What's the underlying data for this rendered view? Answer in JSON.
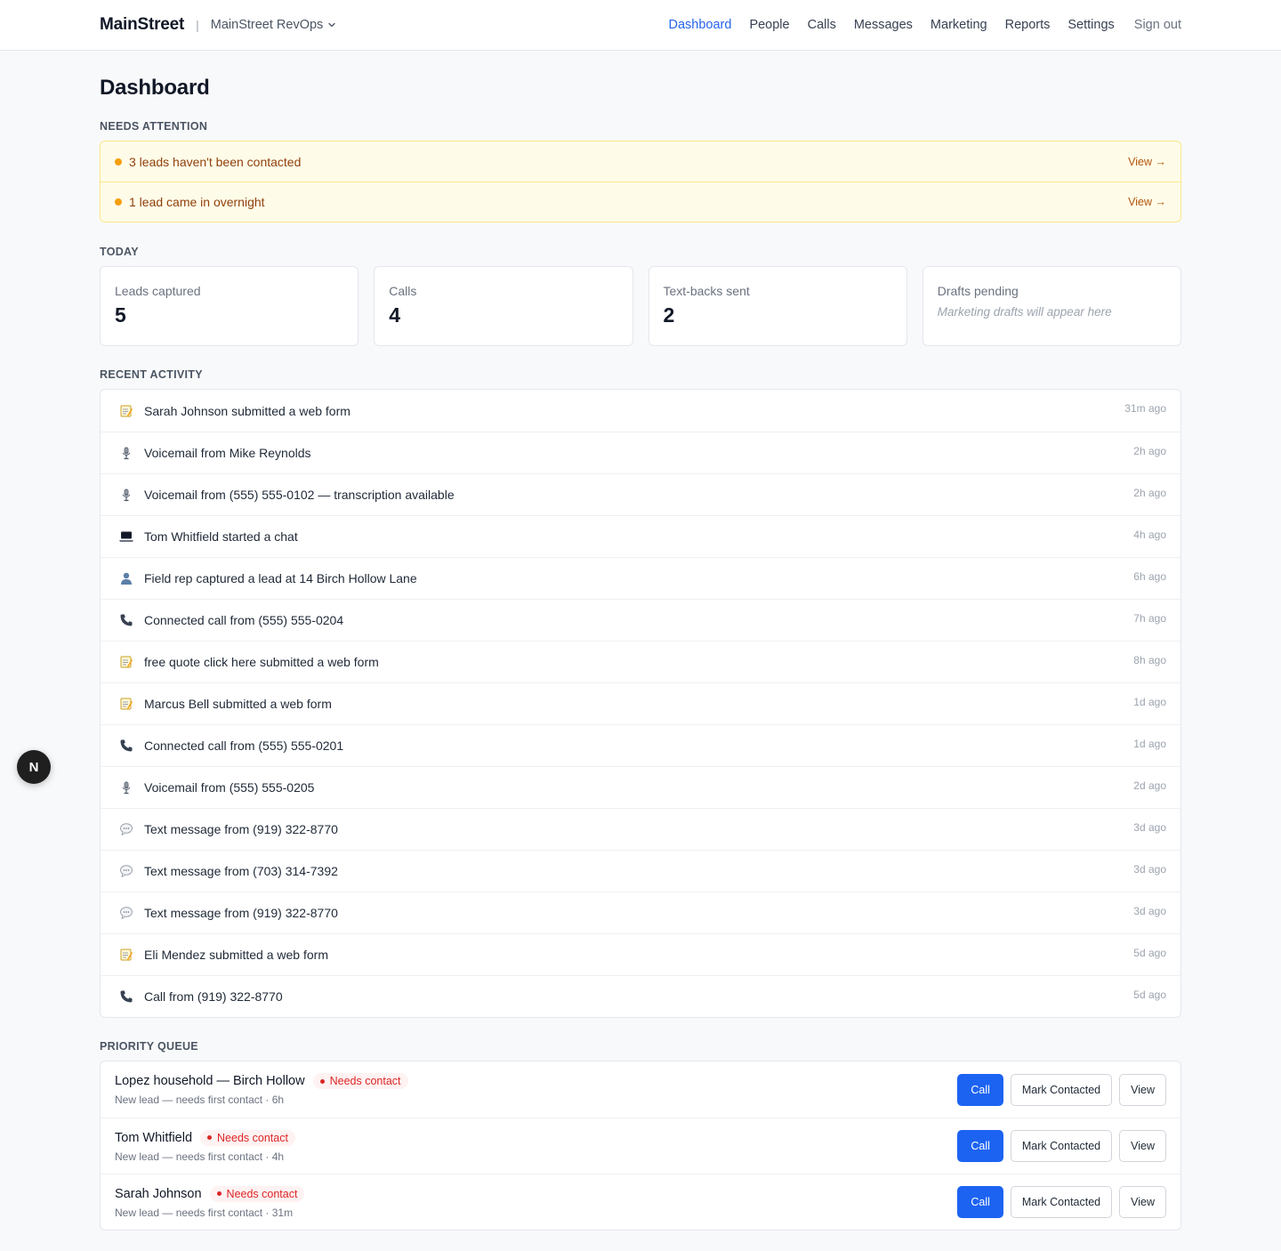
{
  "header": {
    "logo": "MainStreet",
    "separator": "|",
    "org": "MainStreet RevOps",
    "nav": [
      "Dashboard",
      "People",
      "Calls",
      "Messages",
      "Marketing",
      "Reports",
      "Settings"
    ],
    "active_nav": "Dashboard",
    "sign_out": "Sign out"
  },
  "page": {
    "title": "Dashboard"
  },
  "needs_attention": {
    "label": "NEEDS ATTENTION",
    "items": [
      {
        "text": "3 leads haven't been contacted",
        "link": "View →"
      },
      {
        "text": "1 lead came in overnight",
        "link": "View →"
      }
    ]
  },
  "today": {
    "label": "TODAY",
    "stats": [
      {
        "label": "Leads captured",
        "value": "5"
      },
      {
        "label": "Calls",
        "value": "4"
      },
      {
        "label": "Text-backs sent",
        "value": "2"
      },
      {
        "label": "Drafts pending",
        "note": "Marketing drafts will appear here"
      }
    ]
  },
  "recent_activity": {
    "label": "RECENT ACTIVITY",
    "items": [
      {
        "icon": "memo-icon",
        "text": "Sarah Johnson submitted a web form",
        "time": "31m ago"
      },
      {
        "icon": "microphone-icon",
        "text": "Voicemail from Mike Reynolds",
        "time": "2h ago"
      },
      {
        "icon": "microphone-icon",
        "text": "Voicemail from (555) 555-0102 — transcription available",
        "time": "2h ago"
      },
      {
        "icon": "laptop-icon",
        "text": "Tom Whitfield started a chat",
        "time": "4h ago"
      },
      {
        "icon": "person-icon",
        "text": "Field rep captured a lead at 14 Birch Hollow Lane",
        "time": "6h ago"
      },
      {
        "icon": "phone-icon",
        "text": "Connected call from (555) 555-0204",
        "time": "7h ago"
      },
      {
        "icon": "memo-icon",
        "text": "free quote click here submitted a web form",
        "time": "8h ago"
      },
      {
        "icon": "memo-icon",
        "text": "Marcus Bell submitted a web form",
        "time": "1d ago"
      },
      {
        "icon": "phone-icon",
        "text": "Connected call from (555) 555-0201",
        "time": "1d ago"
      },
      {
        "icon": "microphone-icon",
        "text": "Voicemail from (555) 555-0205",
        "time": "2d ago"
      },
      {
        "icon": "speech-bubble-icon",
        "text": "Text message from (919) 322-8770",
        "time": "3d ago"
      },
      {
        "icon": "speech-bubble-icon",
        "text": "Text message from (703) 314-7392",
        "time": "3d ago"
      },
      {
        "icon": "speech-bubble-icon",
        "text": "Text message from (919) 322-8770",
        "time": "3d ago"
      },
      {
        "icon": "memo-icon",
        "text": "Eli Mendez submitted a web form",
        "time": "5d ago"
      },
      {
        "icon": "phone-icon",
        "text": "Call from (919) 322-8770",
        "time": "5d ago"
      }
    ]
  },
  "priority_queue": {
    "label": "PRIORITY QUEUE",
    "items": [
      {
        "name": "Lopez household — Birch Hollow",
        "badge": "Needs contact",
        "sub": "New lead — needs first contact · 6h"
      },
      {
        "name": "Tom Whitfield",
        "badge": "Needs contact",
        "sub": "New lead — needs first contact · 4h"
      },
      {
        "name": "Sarah Johnson",
        "badge": "Needs contact",
        "sub": "New lead — needs first contact · 31m"
      }
    ],
    "buttons": {
      "call": "Call",
      "mark": "Mark Contacted",
      "view": "View"
    }
  },
  "floating_badge": "N",
  "colors": {
    "accent": "#1d63f2",
    "nav_active": "#2563eb",
    "alert_bg": "#fefce8",
    "alert_dot": "#f59e0b",
    "badge_red": "#dc2626"
  }
}
